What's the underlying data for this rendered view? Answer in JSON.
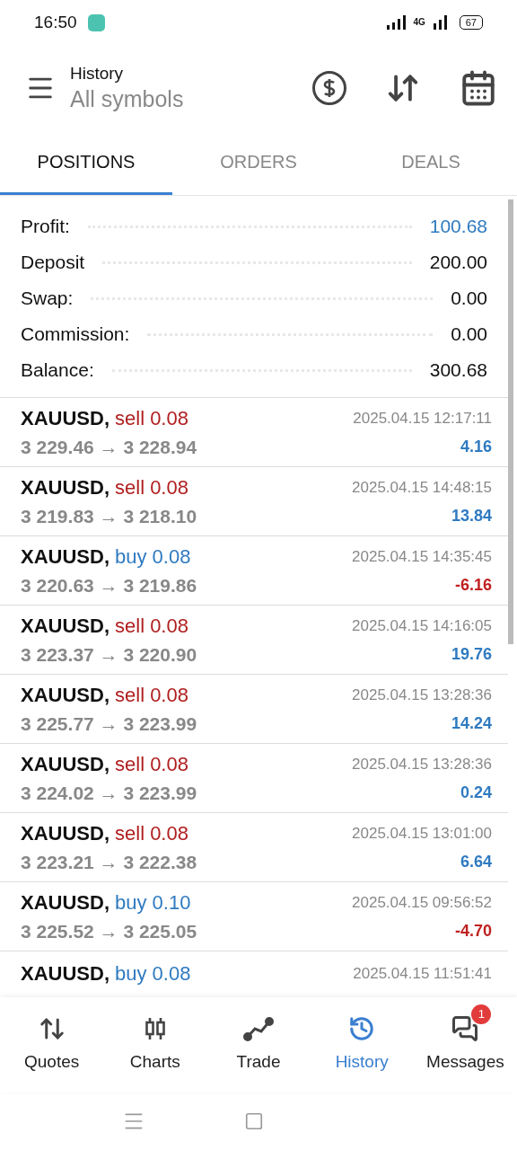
{
  "status_bar": {
    "time": "16:50",
    "battery": "67",
    "network": "4G"
  },
  "header": {
    "title": "History",
    "subtitle": "All symbols"
  },
  "tabs": [
    {
      "label": "POSITIONS",
      "selected": true
    },
    {
      "label": "ORDERS",
      "selected": false
    },
    {
      "label": "DEALS",
      "selected": false
    }
  ],
  "summary": [
    {
      "label": "Profit:",
      "value": "100.68",
      "highlight": true
    },
    {
      "label": "Deposit",
      "value": "200.00",
      "highlight": false
    },
    {
      "label": "Swap:",
      "value": "0.00",
      "highlight": false
    },
    {
      "label": "Commission:",
      "value": "0.00",
      "highlight": false
    },
    {
      "label": "Balance:",
      "value": "300.68",
      "highlight": false
    }
  ],
  "positions": [
    {
      "symbol": "XAUUSD,",
      "kind": "sell",
      "volume": "sell 0.08",
      "prices": "3 229.46 → 3 228.94",
      "time": "2025.04.15 12:17:11",
      "profit": "4.16",
      "loss": false
    },
    {
      "symbol": "XAUUSD,",
      "kind": "sell",
      "volume": "sell 0.08",
      "prices": "3 219.83 → 3 218.10",
      "time": "2025.04.15 14:48:15",
      "profit": "13.84",
      "loss": false
    },
    {
      "symbol": "XAUUSD,",
      "kind": "buy",
      "volume": "buy 0.08",
      "prices": "3 220.63 → 3 219.86",
      "time": "2025.04.15 14:35:45",
      "profit": "-6.16",
      "loss": true
    },
    {
      "symbol": "XAUUSD,",
      "kind": "sell",
      "volume": "sell 0.08",
      "prices": "3 223.37 → 3 220.90",
      "time": "2025.04.15 14:16:05",
      "profit": "19.76",
      "loss": false
    },
    {
      "symbol": "XAUUSD,",
      "kind": "sell",
      "volume": "sell 0.08",
      "prices": "3 225.77 → 3 223.99",
      "time": "2025.04.15 13:28:36",
      "profit": "14.24",
      "loss": false
    },
    {
      "symbol": "XAUUSD,",
      "kind": "sell",
      "volume": "sell 0.08",
      "prices": "3 224.02 → 3 223.99",
      "time": "2025.04.15 13:28:36",
      "profit": "0.24",
      "loss": false
    },
    {
      "symbol": "XAUUSD,",
      "kind": "sell",
      "volume": "sell 0.08",
      "prices": "3 223.21 → 3 222.38",
      "time": "2025.04.15 13:01:00",
      "profit": "6.64",
      "loss": false
    },
    {
      "symbol": "XAUUSD,",
      "kind": "buy",
      "volume": "buy 0.10",
      "prices": "3 225.52 → 3 225.05",
      "time": "2025.04.15 09:56:52",
      "profit": "-4.70",
      "loss": true
    },
    {
      "symbol": "XAUUSD,",
      "kind": "buy",
      "volume": "buy 0.08",
      "time": "2025.04.15 11:51:41"
    }
  ],
  "bottom_nav": [
    {
      "label": "Quotes",
      "selected": false,
      "kind": "quotes"
    },
    {
      "label": "Charts",
      "selected": false,
      "kind": "charts"
    },
    {
      "label": "Trade",
      "selected": false,
      "kind": "trade"
    },
    {
      "label": "History",
      "selected": true,
      "kind": "history"
    },
    {
      "label": "Messages",
      "selected": false,
      "kind": "messages",
      "badge": "1"
    }
  ]
}
